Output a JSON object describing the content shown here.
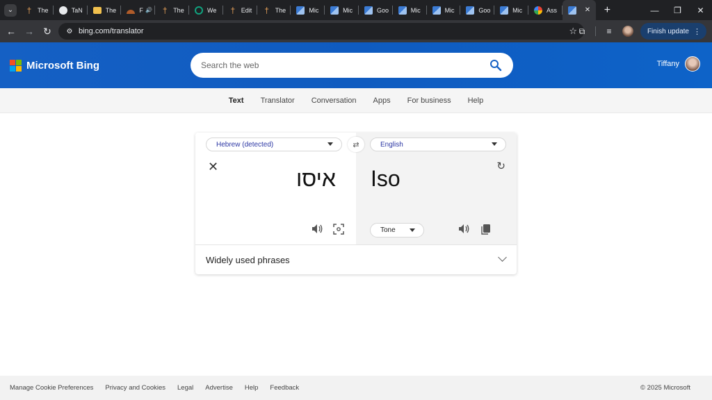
{
  "browser": {
    "tabs": [
      {
        "title": "The",
        "icon": "cross-icon"
      },
      {
        "title": "TaN",
        "icon": "globe-icon"
      },
      {
        "title": "The",
        "icon": "book-icon"
      },
      {
        "title": "F",
        "icon": "hat-icon",
        "audio": true
      },
      {
        "title": "The",
        "icon": "cross-icon"
      },
      {
        "title": "We",
        "icon": "openai-icon"
      },
      {
        "title": "Edit",
        "icon": "cross-icon"
      },
      {
        "title": "The",
        "icon": "cross-icon"
      },
      {
        "title": "Mic",
        "icon": "translator-icon"
      },
      {
        "title": "Mic",
        "icon": "translator-icon"
      },
      {
        "title": "Goo",
        "icon": "translator-icon"
      },
      {
        "title": "Mic",
        "icon": "translator-icon"
      },
      {
        "title": "Mic",
        "icon": "translator-icon"
      },
      {
        "title": "Goo",
        "icon": "translator-icon"
      },
      {
        "title": "Mic",
        "icon": "translator-icon"
      },
      {
        "title": "Ass",
        "icon": "google-icon"
      },
      {
        "title": "",
        "icon": "translator-icon",
        "active": true
      }
    ],
    "url": "bing.com/translator",
    "finish_update_label": "Finish update"
  },
  "header": {
    "brand": "Microsoft Bing",
    "search_placeholder": "Search the web",
    "user_name": "Tiffany"
  },
  "subnav": {
    "items": [
      "Text",
      "Translator",
      "Conversation",
      "Apps",
      "For business",
      "Help"
    ],
    "active": "Text"
  },
  "translator": {
    "source_language": "Hebrew (detected)",
    "target_language": "English",
    "source_text": "איסו",
    "target_text": "Iso",
    "tone_label": "Tone",
    "phrases_label": "Widely used phrases"
  },
  "footer": {
    "links": [
      "Manage Cookie Preferences",
      "Privacy and Cookies",
      "Legal",
      "Advertise",
      "Help",
      "Feedback"
    ],
    "copyright": "© 2025 Microsoft"
  },
  "colors": {
    "bing_blue": "#1560c4",
    "language_text": "#2b36a3",
    "chrome_dark": "#202124"
  }
}
